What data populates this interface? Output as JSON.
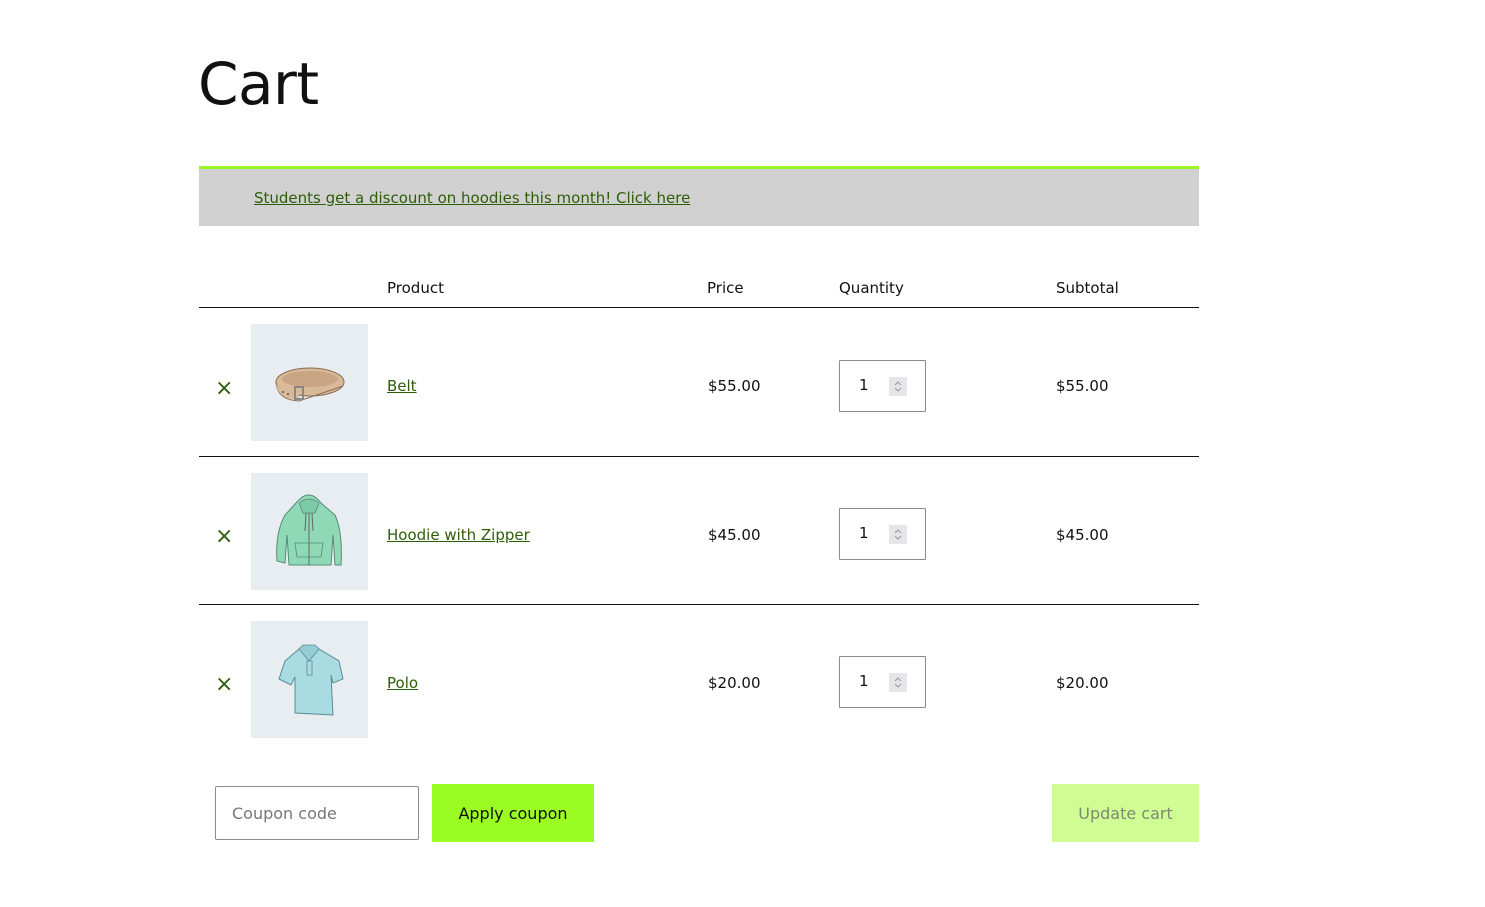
{
  "page": {
    "title": "Cart"
  },
  "notice": {
    "text": "Students get a discount on hoodies this month! Click here"
  },
  "table": {
    "headers": {
      "product": "Product",
      "price": "Price",
      "quantity": "Quantity",
      "subtotal": "Subtotal"
    },
    "rows": [
      {
        "name": "Belt",
        "price": "$55.00",
        "quantity": "1",
        "subtotal": "$55.00",
        "image": "belt-image",
        "remove": "×"
      },
      {
        "name": "Hoodie with Zipper",
        "price": "$45.00",
        "quantity": "1",
        "subtotal": "$45.00",
        "image": "hoodie-image",
        "remove": "×"
      },
      {
        "name": "Polo",
        "price": "$20.00",
        "quantity": "1",
        "subtotal": "$20.00",
        "image": "polo-image",
        "remove": "×"
      }
    ]
  },
  "actions": {
    "coupon_placeholder": "Coupon code",
    "coupon_value": "",
    "apply_label": "Apply coupon",
    "update_label": "Update cart"
  },
  "colors": {
    "accent": "#9afc22",
    "link": "#2e5d08",
    "notice_bg": "#d1d1d1",
    "update_disabled": "#d0fd93"
  }
}
